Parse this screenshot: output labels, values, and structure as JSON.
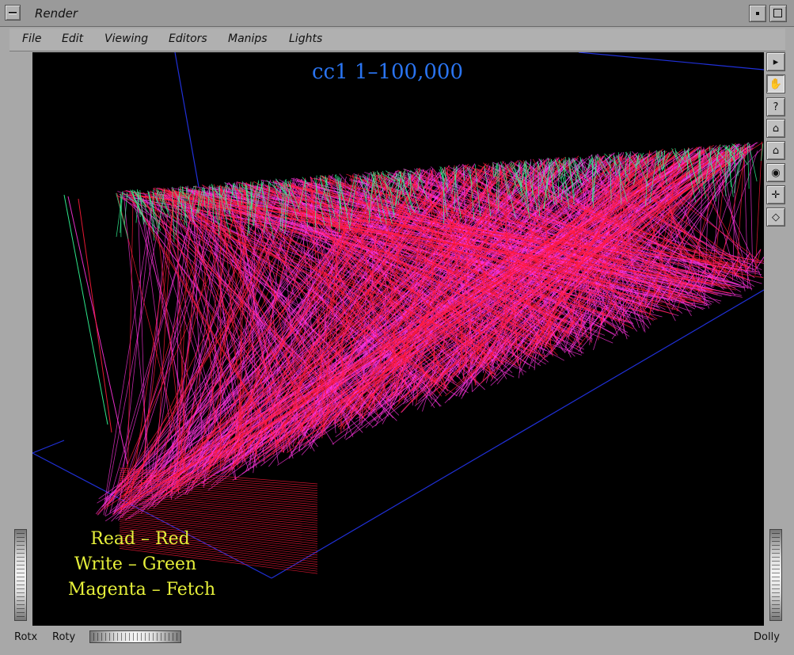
{
  "window": {
    "title": "Render"
  },
  "menu": {
    "items": [
      "File",
      "Edit",
      "Viewing",
      "Editors",
      "Manips",
      "Lights"
    ]
  },
  "viewport": {
    "title": "cc1  1–100,000",
    "legend": [
      "Read – Red",
      "Write – Green",
      "Magenta – Fetch"
    ],
    "colors": {
      "read": "#ff1a3a",
      "write": "#33ff99",
      "fetch": "#ff33dd",
      "box": "#2030d8",
      "title": "#2a74f0",
      "legend": "#e6f03a"
    }
  },
  "toolbar": {
    "buttons": [
      {
        "name": "pick-arrow-icon",
        "glyph": "▸"
      },
      {
        "name": "view-hand-icon",
        "glyph": "✋"
      },
      {
        "name": "help-icon",
        "glyph": "?"
      },
      {
        "name": "home-icon",
        "glyph": "⌂"
      },
      {
        "name": "set-home-icon",
        "glyph": "⌂"
      },
      {
        "name": "view-all-icon",
        "glyph": "◉"
      },
      {
        "name": "seek-icon",
        "glyph": "✛"
      },
      {
        "name": "perspective-icon",
        "glyph": "◇"
      }
    ]
  },
  "bottom": {
    "rotx": "Rotx",
    "roty": "Roty",
    "dolly": "Dolly"
  }
}
